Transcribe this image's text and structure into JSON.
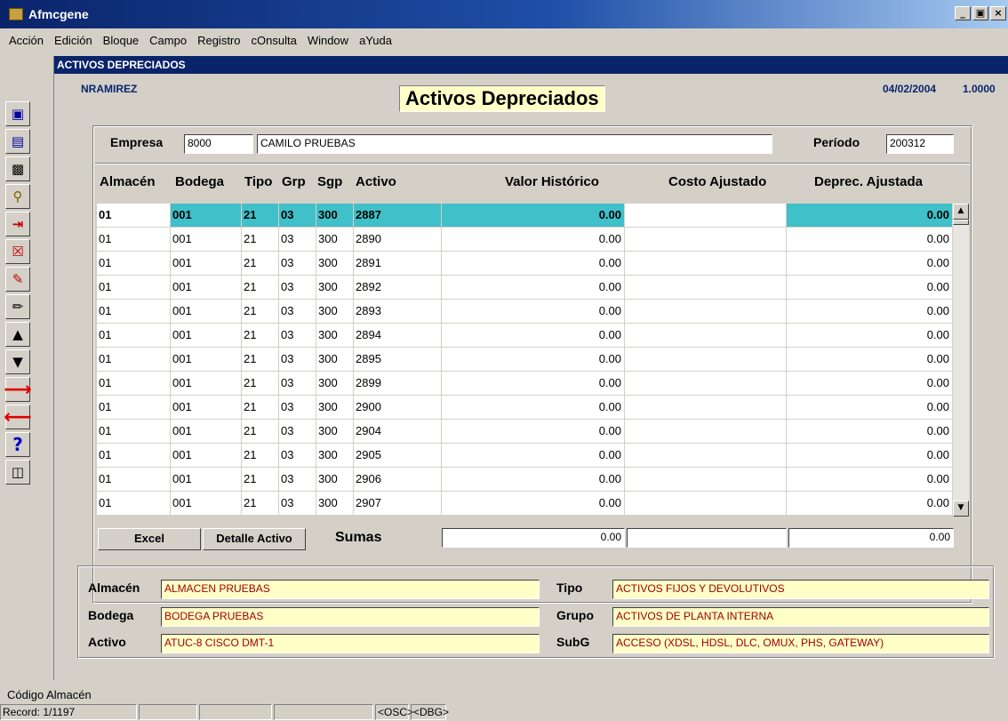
{
  "window": {
    "title": "Afmcgene",
    "minimize": "_",
    "maximize": "8",
    "close": "×"
  },
  "menu": [
    "Acción",
    "Edición",
    "Bloque",
    "Campo",
    "Registro",
    "cOnsulta",
    "Window",
    "aYuda"
  ],
  "toolbar": {
    "icons": [
      "save-icon",
      "list-icon",
      "clipboard-icon",
      "query-icon",
      "insert-record-icon",
      "delete-record-icon",
      "clear-icon",
      "edit-icon",
      "previous-block-icon",
      "next-block-icon",
      "next-record-icon",
      "previous-record-icon",
      "help-icon",
      "exit-icon"
    ]
  },
  "form": {
    "bar_title": "ACTIVOS DEPRECIADOS",
    "user": "NRAMIREZ",
    "title": "Activos Depreciados",
    "date": "04/02/2004",
    "version": "1.0000"
  },
  "header": {
    "empresa_label": "Empresa",
    "empresa_code": "8000",
    "empresa_name": "CAMILO PRUEBAS",
    "periodo_label": "Período",
    "periodo_value": "200312"
  },
  "grid": {
    "columns": [
      "Almacén",
      "Bodega",
      "Tipo",
      "Grp",
      "Sgp",
      "Activo",
      "Valor Histórico",
      "Costo Ajustado",
      "Deprec. Ajustada"
    ],
    "rows": [
      [
        "01",
        "001",
        "21",
        "03",
        "300",
        "2887",
        "0.00",
        "",
        "0.00"
      ],
      [
        "01",
        "001",
        "21",
        "03",
        "300",
        "2890",
        "0.00",
        "",
        "0.00"
      ],
      [
        "01",
        "001",
        "21",
        "03",
        "300",
        "2891",
        "0.00",
        "",
        "0.00"
      ],
      [
        "01",
        "001",
        "21",
        "03",
        "300",
        "2892",
        "0.00",
        "",
        "0.00"
      ],
      [
        "01",
        "001",
        "21",
        "03",
        "300",
        "2893",
        "0.00",
        "",
        "0.00"
      ],
      [
        "01",
        "001",
        "21",
        "03",
        "300",
        "2894",
        "0.00",
        "",
        "0.00"
      ],
      [
        "01",
        "001",
        "21",
        "03",
        "300",
        "2895",
        "0.00",
        "",
        "0.00"
      ],
      [
        "01",
        "001",
        "21",
        "03",
        "300",
        "2899",
        "0.00",
        "",
        "0.00"
      ],
      [
        "01",
        "001",
        "21",
        "03",
        "300",
        "2900",
        "0.00",
        "",
        "0.00"
      ],
      [
        "01",
        "001",
        "21",
        "03",
        "300",
        "2904",
        "0.00",
        "",
        "0.00"
      ],
      [
        "01",
        "001",
        "21",
        "03",
        "300",
        "2905",
        "0.00",
        "",
        "0.00"
      ],
      [
        "01",
        "001",
        "21",
        "03",
        "300",
        "2906",
        "0.00",
        "",
        "0.00"
      ],
      [
        "01",
        "001",
        "21",
        "03",
        "300",
        "2907",
        "0.00",
        "",
        "0.00"
      ]
    ]
  },
  "buttons": {
    "excel": "Excel",
    "detalle": "Detalle Activo"
  },
  "sumas": {
    "label": "Sumas",
    "valor_historico": "0.00",
    "costo_ajustado": "",
    "deprec_ajustada": "0.00"
  },
  "details": {
    "almacen_label": "Almacén",
    "almacen_value": "ALMACEN PRUEBAS",
    "bodega_label": "Bodega",
    "bodega_value": "BODEGA PRUEBAS",
    "activo_label": "Activo",
    "activo_value": "ATUC-8 CISCO DMT-1",
    "tipo_label": "Tipo",
    "tipo_value": "ACTIVOS FIJOS Y DEVOLUTIVOS",
    "grupo_label": "Grupo",
    "grupo_value": "ACTIVOS DE PLANTA INTERNA",
    "subg_label": "SubG",
    "subg_value": "ACCESO (XDSL, HDSL, DLC, OMUX, PHS, GATEWAY)"
  },
  "status": {
    "hint": "Código Almacén",
    "record": "Record: 1/1197",
    "osc": "<OSC>",
    "dbg": "<DBG>"
  }
}
